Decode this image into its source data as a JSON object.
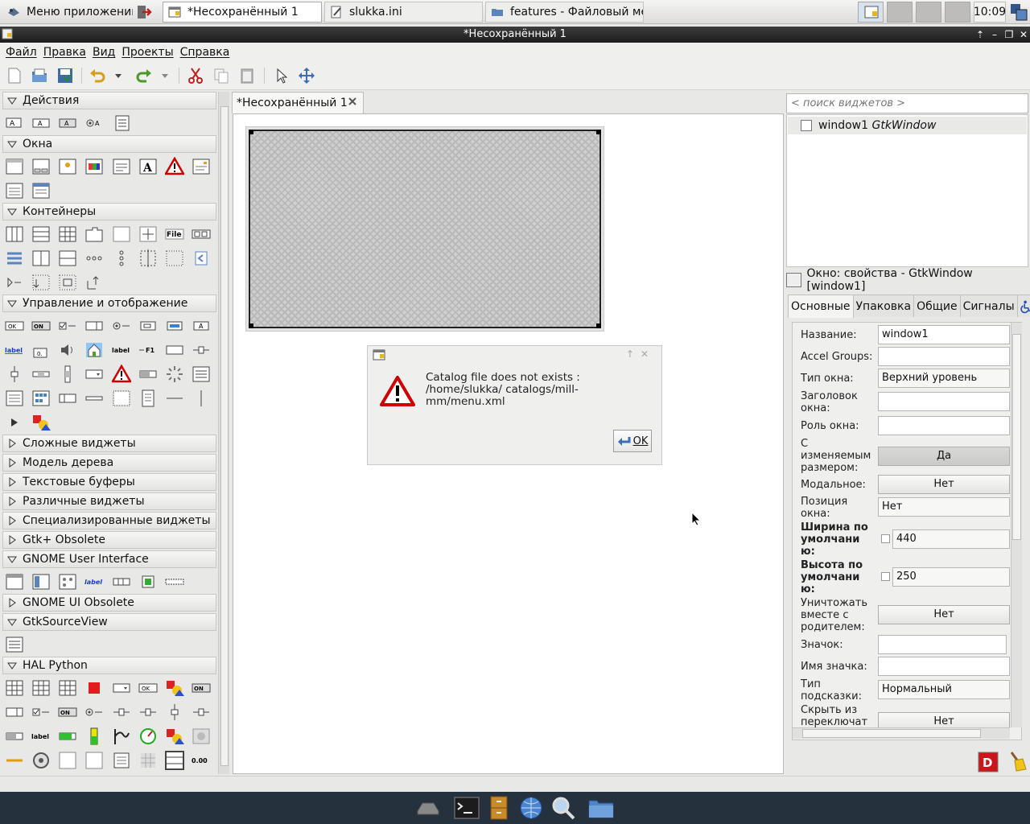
{
  "taskbar": {
    "app_menu": "Меню приложений",
    "tasks": [
      "*Несохранённый 1",
      "slukka.ini",
      "features - Файловый ме..."
    ],
    "clock": "10:09"
  },
  "window": {
    "title": "*Несохранённый 1"
  },
  "menu": [
    "Файл",
    "Правка",
    "Вид",
    "Проекты",
    "Справка"
  ],
  "palette": {
    "groups": [
      "Действия",
      "Окна",
      "Контейнеры",
      "Управление и отображение",
      "Сложные виджеты",
      "Модель дерева",
      "Текстовые буферы",
      "Различные виджеты",
      "Специализированные виджеты",
      "Gtk+ Obsolete",
      "GNOME User Interface",
      "GNOME UI Obsolete",
      "GtkSourceView",
      "HAL Python"
    ]
  },
  "document": {
    "tab": "*Несохранённый 1"
  },
  "dialog": {
    "message": "Catalog file does not exists : /home/slukka/ catalogs/mill-mm/menu.xml",
    "ok": "OK"
  },
  "inspector": {
    "search_placeholder": "< поиск виджетов >",
    "tree_name": "window1",
    "tree_type": "GtkWindow",
    "props_title": "Окно: свойства - GtkWindow [window1]",
    "tabs": [
      "Основные",
      "Упаковка",
      "Общие",
      "Сигналы"
    ],
    "rows": {
      "name_label": "Название:",
      "name_value": "window1",
      "accel_label": "Accel Groups:",
      "type_label": "Тип окна:",
      "type_value": "Верхний уровень",
      "title_label": "Заголовок окна:",
      "role_label": "Роль окна:",
      "resizable_label": "С изменяемым размером:",
      "resizable_value": "Да",
      "modal_label": "Модальное:",
      "modal_value": "Нет",
      "position_label": "Позиция окна:",
      "position_value": "Нет",
      "width_label": "Ширина по умолчани ю:",
      "width_value": "440",
      "height_label": "Высота по умолчани ю:",
      "height_value": "250",
      "destroy_label": "Уничтожать вместе с родителем:",
      "destroy_value": "Нет",
      "icon_label": "Значок:",
      "icon_name_label": "Имя значка:",
      "hint_label": "Тип подсказки:",
      "hint_value": "Нормальный",
      "skip_label": "Скрыть из переключат",
      "skip_value": "Нет"
    }
  }
}
